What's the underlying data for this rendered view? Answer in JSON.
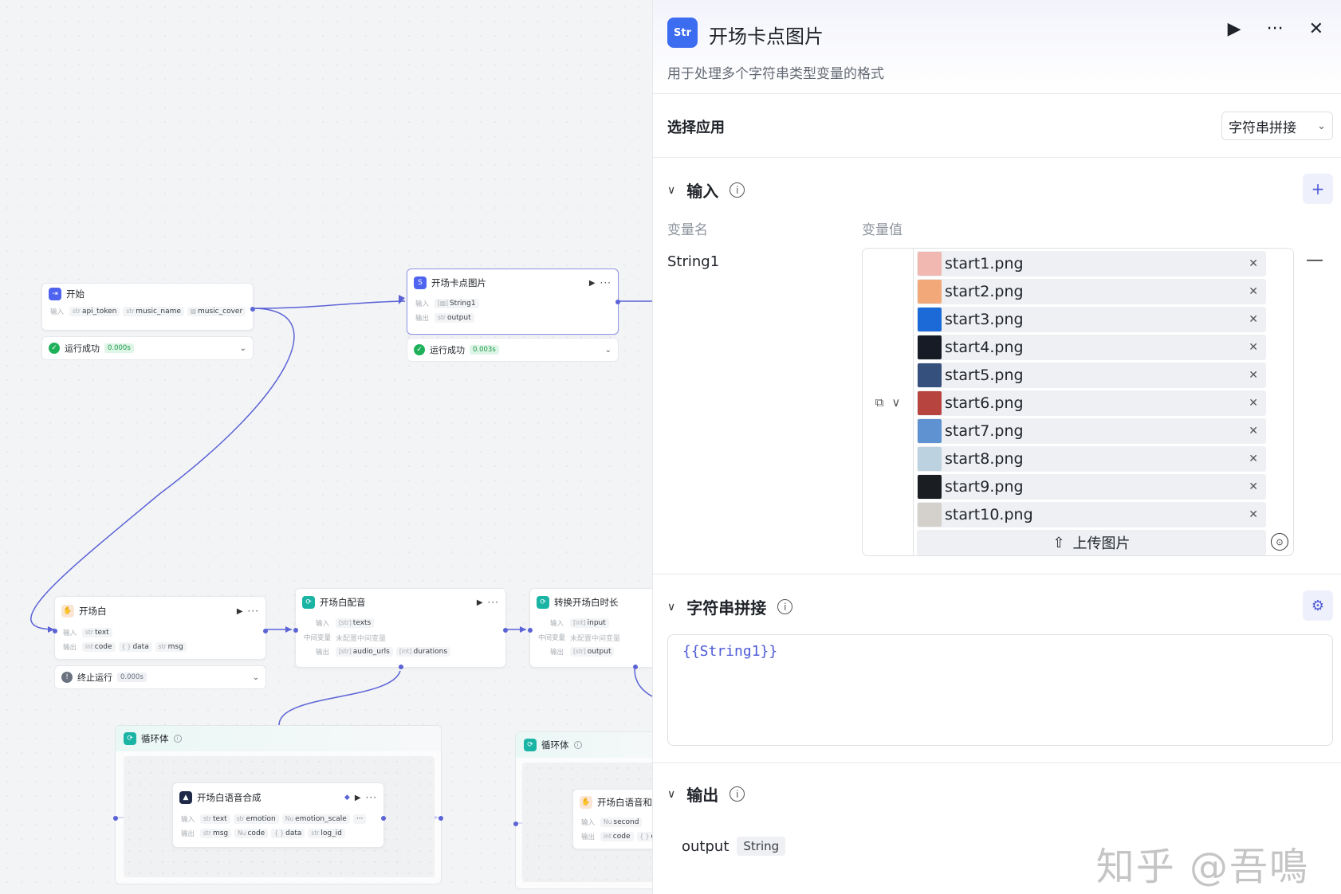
{
  "canvas": {
    "nodes": {
      "start": {
        "title": "开始",
        "in_label": "输入",
        "inputs": [
          {
            "type": "str",
            "name": "api_token"
          },
          {
            "type": "str",
            "name": "music_name"
          },
          {
            "type": "▨",
            "name": "music_cover"
          }
        ]
      },
      "card": {
        "title": "开场卡点图片",
        "in_label": "输入",
        "out_label": "输出",
        "input": {
          "type": "[▨]",
          "name": "String1"
        },
        "output": {
          "type": "str",
          "name": "output"
        }
      },
      "opening": {
        "title": "开场白",
        "in_label": "输入",
        "out_label": "输出",
        "input": {
          "type": "str",
          "name": "text"
        },
        "outputs": [
          {
            "type": "int",
            "name": "code"
          },
          {
            "type": "{ }",
            "name": "data"
          },
          {
            "type": "str",
            "name": "msg"
          }
        ]
      },
      "dubbing": {
        "title": "开场白配音",
        "in_label": "输入",
        "mid_label": "中间变量",
        "out_label": "输出",
        "input": {
          "type": "[str]",
          "name": "texts"
        },
        "mid_value": "未配置中间变量",
        "outputs": [
          {
            "type": "[str]",
            "name": "audio_urls"
          },
          {
            "type": "[int]",
            "name": "durations"
          }
        ]
      },
      "convert": {
        "title": "转换开场白时长",
        "in_label": "输入",
        "mid_label": "中间变量",
        "out_label": "输出",
        "input": {
          "type": "[int]",
          "name": "input"
        },
        "mid_value": "未配置中间变量",
        "output": {
          "type": "[str]",
          "name": "output"
        }
      },
      "loop1": {
        "title": "循环体"
      },
      "tts": {
        "title": "开场白语音合成",
        "in_label": "输入",
        "out_label": "输出",
        "inputs": [
          {
            "type": "str",
            "name": "text"
          },
          {
            "type": "str",
            "name": "emotion"
          },
          {
            "type": "Nu",
            "name": "emotion_scale"
          }
        ],
        "more": "···",
        "outputs": [
          {
            "type": "str",
            "name": "msg"
          },
          {
            "type": "Nu",
            "name": "code"
          },
          {
            "type": "{ }",
            "name": "data"
          },
          {
            "type": "str",
            "name": "log_id"
          }
        ]
      },
      "loop2": {
        "title": "循环体"
      },
      "tts2": {
        "title": "开场白语音和",
        "in_label": "输入",
        "out_label": "输出",
        "input": {
          "type": "Nu",
          "name": "second"
        },
        "outputs": [
          {
            "type": "int",
            "name": "code"
          },
          {
            "type": "{ }",
            "name": "da"
          }
        ]
      }
    },
    "statuses": {
      "start": {
        "text": "运行成功",
        "time": "0.000s"
      },
      "card": {
        "text": "运行成功",
        "time": "0.003s"
      },
      "opening": {
        "text": "终止运行",
        "time": "0.000s"
      }
    }
  },
  "panel": {
    "logo_text": "Str",
    "title": "开场卡点图片",
    "description": "用于处理多个字符串类型变量的格式",
    "app_label": "选择应用",
    "app_value": "字符串拼接",
    "input_section": {
      "title": "输入",
      "col_name": "变量名",
      "col_value": "变量值",
      "var_name": "String1",
      "upload_label": "上传图片",
      "files": [
        {
          "name": "start1.png",
          "color": "#f0b8b0"
        },
        {
          "name": "start2.png",
          "color": "#f2a878"
        },
        {
          "name": "start3.png",
          "color": "#1c6ad8"
        },
        {
          "name": "start4.png",
          "color": "#161b26"
        },
        {
          "name": "start5.png",
          "color": "#36507e"
        },
        {
          "name": "start6.png",
          "color": "#b84440"
        },
        {
          "name": "start7.png",
          "color": "#5e92d0"
        },
        {
          "name": "start8.png",
          "color": "#bcd2e0"
        },
        {
          "name": "start9.png",
          "color": "#1a1d22"
        },
        {
          "name": "start10.png",
          "color": "#d4d0cc"
        }
      ]
    },
    "concat_section": {
      "title": "字符串拼接",
      "template": "{{String1}}"
    },
    "output_section": {
      "title": "输出",
      "name": "output",
      "type": "String"
    },
    "watermark": "知乎 @吾鳴"
  }
}
